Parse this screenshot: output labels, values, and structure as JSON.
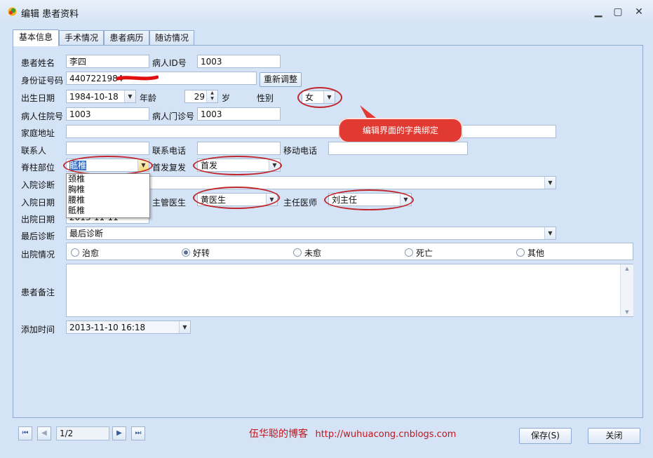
{
  "window": {
    "title": "编辑 患者资料",
    "minimize": "▁",
    "maximize": "▢",
    "close": "✕"
  },
  "tabs": [
    {
      "label": "基本信息"
    },
    {
      "label": "手术情况"
    },
    {
      "label": "患者病历"
    },
    {
      "label": "随访情况"
    }
  ],
  "form": {
    "name_label": "患者姓名",
    "name_value": "李四",
    "pid_label": "病人ID号",
    "pid_value": "1003",
    "idcard_label": "身份证号码",
    "idcard_value": "4407221984",
    "readjust_button": "重新调整",
    "birth_label": "出生日期",
    "birth_value": "1984-10-18",
    "age_label": "年龄",
    "age_value": "29",
    "age_unit": "岁",
    "gender_label": "性别",
    "gender_value": "女",
    "inpatient_label": "病人住院号",
    "inpatient_value": "1003",
    "outpatient_label": "病人门诊号",
    "outpatient_value": "1003",
    "address_label": "家庭地址",
    "address_value": "",
    "contact_label": "联系人",
    "contact_value": "",
    "phone_label": "联系电话",
    "phone_value": "",
    "mobile_label": "移动电话",
    "mobile_value": "",
    "spine_label": "脊柱部位",
    "spine_value": "骶椎",
    "spine_options": [
      "颈椎",
      "胸椎",
      "腰椎",
      "骶椎"
    ],
    "first_label": "首发复发",
    "first_value": "首发",
    "admit_diag_label": "入院诊断",
    "admit_diag_value": "",
    "admit_date_label": "入院日期",
    "attending_label": "主管医生",
    "attending_value": "黄医生",
    "director_label": "主任医师",
    "director_value": "刘主任",
    "discharge_date_label": "出院日期",
    "discharge_date_value": "2013-11-11",
    "final_diag_label": "最后诊断",
    "final_diag_value": "最后诊断",
    "discharge_status_label": "出院情况",
    "discharge_options": [
      {
        "label": "治愈",
        "checked": false
      },
      {
        "label": "好转",
        "checked": true
      },
      {
        "label": "未愈",
        "checked": false
      },
      {
        "label": "死亡",
        "checked": false
      },
      {
        "label": "其他",
        "checked": false
      }
    ],
    "notes_label": "患者备注",
    "notes_value": "",
    "added_label": "添加时间",
    "added_value": "2013-11-10 16:18"
  },
  "callout_text": "编辑界面的字典绑定",
  "pager": {
    "page": "1/2"
  },
  "footer": {
    "blog_name": "伍华聪的博客",
    "blog_url": "http://wuhuacong.cnblogs.com"
  },
  "buttons": {
    "save": "保存(S)",
    "close": "关闭"
  },
  "colors": {
    "accent_red": "#c0272d",
    "callout_bg": "#e03a32",
    "panel_bg": "#d4e3f5"
  }
}
